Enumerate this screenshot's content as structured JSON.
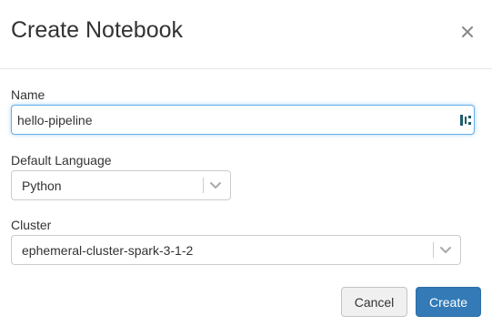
{
  "dialog": {
    "title": "Create Notebook",
    "close_icon": "close-icon"
  },
  "form": {
    "name": {
      "label": "Name",
      "value": "hello-pipeline",
      "icon": "password-manager-icon"
    },
    "language": {
      "label": "Default Language",
      "value": "Python",
      "icon": "chevron-down-icon"
    },
    "cluster": {
      "label": "Cluster",
      "value": "ephemeral-cluster-spark-3-1-2",
      "icon": "chevron-down-icon"
    }
  },
  "footer": {
    "cancel_label": "Cancel",
    "create_label": "Create"
  },
  "colors": {
    "primary": "#337ab7",
    "focus_border": "#66afe9",
    "text": "#333333",
    "icon": "#888888",
    "password_icon": "#1b5e6b"
  }
}
